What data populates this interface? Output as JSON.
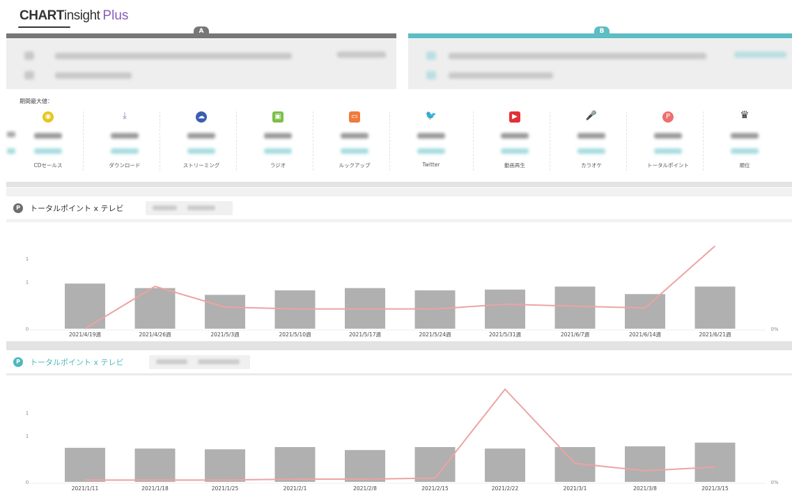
{
  "brand": {
    "part1": "CHART",
    "part2": "insight",
    "part3": "Plus"
  },
  "compare": {
    "a_label": "A",
    "b_label": "B"
  },
  "stats": {
    "label": "期間最大値：",
    "columns": [
      {
        "name": "CDセールス",
        "icon": "cd-icon",
        "color": "#e8c51c",
        "glyph": "◉"
      },
      {
        "name": "ダウンロード",
        "icon": "download-icon",
        "color": "#8b6fc4",
        "glyph": "⤓"
      },
      {
        "name": "ストリーミング",
        "icon": "cloud-music-icon",
        "color": "#3a5fb0",
        "glyph": "☁"
      },
      {
        "name": "ラジオ",
        "icon": "radio-icon",
        "color": "#7cbf4a",
        "glyph": "▣"
      },
      {
        "name": "ルックアップ",
        "icon": "lookup-icon",
        "color": "#f07b3c",
        "glyph": "▭"
      },
      {
        "name": "Twitter",
        "icon": "twitter-icon",
        "color": "#3fa6e8",
        "glyph": "🐦"
      },
      {
        "name": "動画再生",
        "icon": "video-play-icon",
        "color": "#e0303a",
        "glyph": "▶"
      },
      {
        "name": "カラオケ",
        "icon": "microphone-icon",
        "color": "#2a9c8c",
        "glyph": "🎤"
      },
      {
        "name": "トータルポイント",
        "icon": "points-icon",
        "color": "#ee6f6f",
        "glyph": "P"
      },
      {
        "name": "順位",
        "icon": "crown-icon",
        "color": "#333333",
        "glyph": "♛"
      }
    ]
  },
  "charts": {
    "a": {
      "badge": "P",
      "title": "トータルポイント x テレビ",
      "color": "#6e6e6e"
    },
    "b": {
      "badge": "P",
      "title": "トータルポイント x テレビ",
      "color": "#4fb8be"
    }
  },
  "chart_data": [
    {
      "type": "bar",
      "categories": [
        "2021/4/19週",
        "2021/4/26週",
        "2021/5/3週",
        "2021/5/10週",
        "2021/5/17週",
        "2021/5/24週",
        "2021/5/31週",
        "2021/6/7週",
        "2021/6/14週",
        "2021/6/21週"
      ],
      "series": [
        {
          "type": "bar",
          "values": [
            0.6,
            0.54,
            0.45,
            0.51,
            0.54,
            0.51,
            0.52,
            0.56,
            0.46,
            0.56
          ],
          "color": "#b0b0b0"
        },
        {
          "type": "line",
          "values": [
            0.0,
            0.45,
            0.23,
            0.21,
            0.21,
            0.21,
            0.26,
            0.24,
            0.22,
            0.88
          ],
          "color": "#eda3a3"
        }
      ],
      "left_ticks": [
        "0",
        "1",
        "1"
      ],
      "right_ticks": [
        "0%"
      ]
    },
    {
      "type": "bar",
      "categories": [
        "2021/1/11",
        "2021/1/18",
        "2021/1/25",
        "2021/2/1",
        "2021/2/8",
        "2021/2/15",
        "2021/2/22",
        "2021/3/1",
        "2021/3/8",
        "2021/3/15"
      ],
      "series": [
        {
          "type": "bar",
          "values": [
            0.46,
            0.45,
            0.44,
            0.47,
            0.43,
            0.47,
            0.45,
            0.47,
            0.48,
            0.53
          ],
          "color": "#b0b0b0"
        },
        {
          "type": "line",
          "values": [
            0.02,
            0.02,
            0.02,
            0.03,
            0.03,
            0.04,
            1.0,
            0.2,
            0.12,
            0.16
          ],
          "color": "#eda3a3"
        }
      ],
      "left_ticks": [
        "0",
        "1",
        "1"
      ],
      "right_ticks": [
        "0%"
      ]
    }
  ]
}
